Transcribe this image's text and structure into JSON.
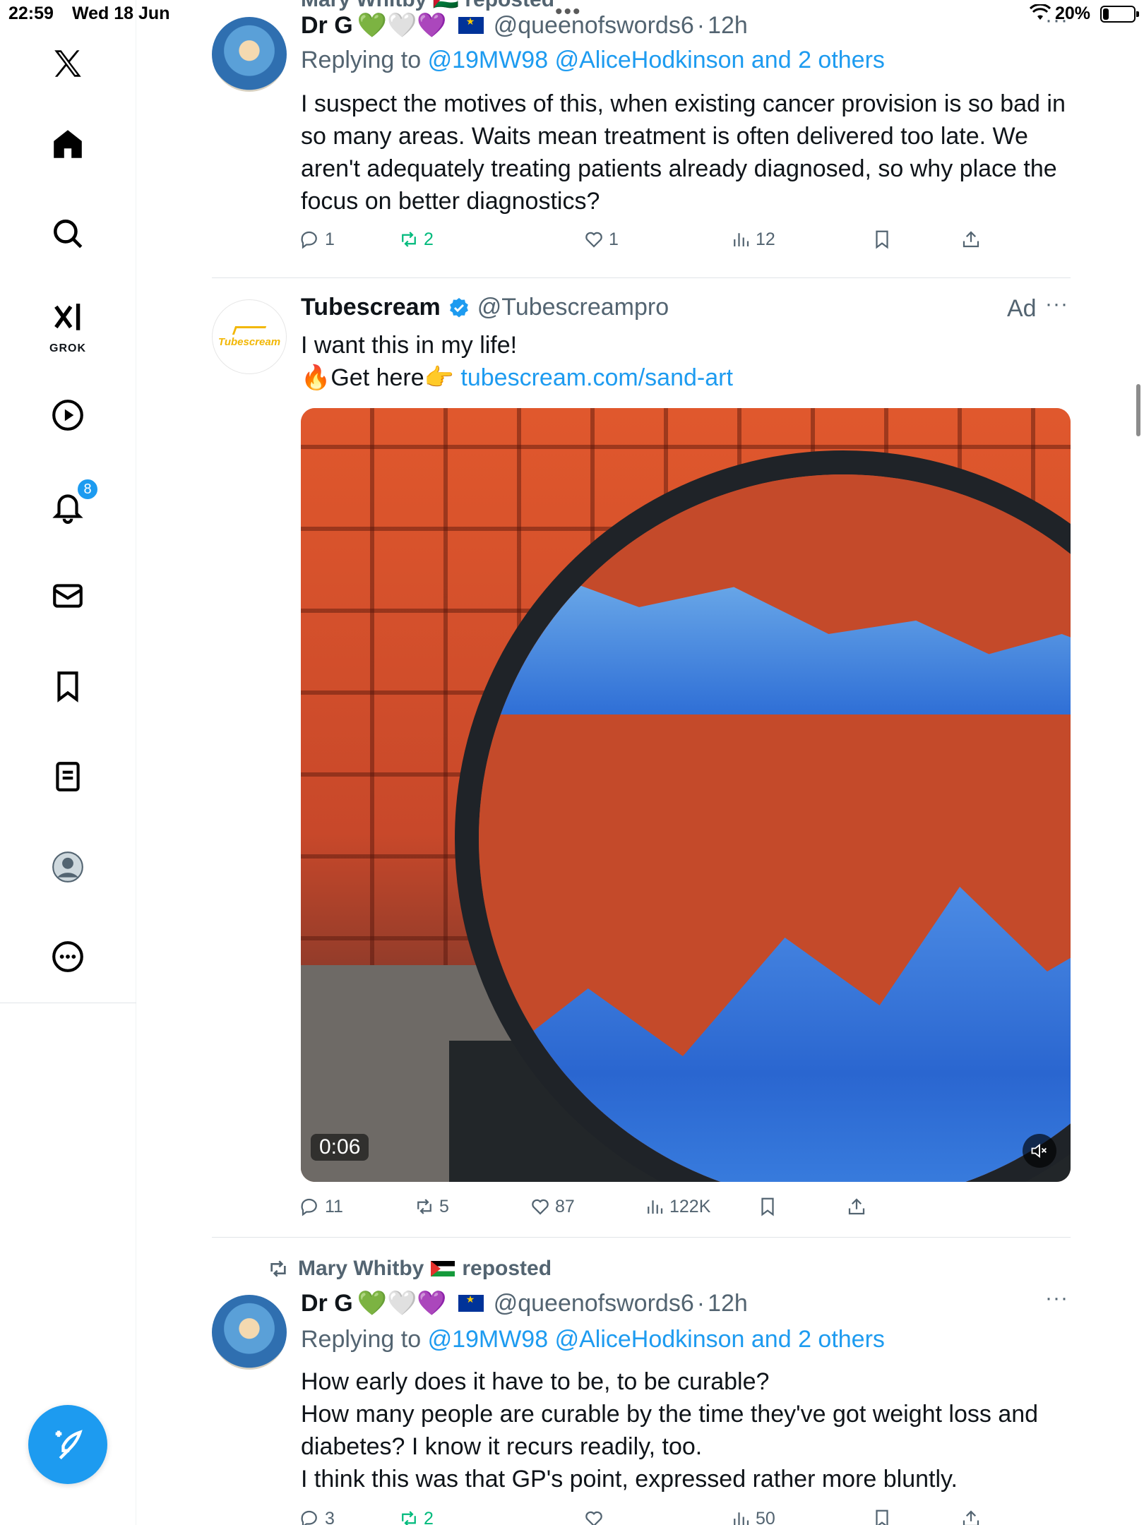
{
  "status_bar": {
    "time": "22:59",
    "date": "Wed 18 Jun",
    "battery_pct": "20%",
    "battery_level": 0.2
  },
  "sidebar": {
    "items": [
      {
        "name": "x-logo",
        "icon": "x-logo-icon"
      },
      {
        "name": "home",
        "icon": "home-icon"
      },
      {
        "name": "explore",
        "icon": "search-icon"
      },
      {
        "name": "grok",
        "icon": "grok-icon",
        "label": "GROK"
      },
      {
        "name": "videos",
        "icon": "play-icon"
      },
      {
        "name": "notifications",
        "icon": "bell-icon",
        "badge": "8"
      },
      {
        "name": "messages",
        "icon": "mail-icon"
      },
      {
        "name": "bookmarks",
        "icon": "bookmark-icon"
      },
      {
        "name": "lists",
        "icon": "list-icon"
      },
      {
        "name": "profile",
        "icon": "avatar-icon"
      },
      {
        "name": "more",
        "icon": "more-circle-icon"
      }
    ],
    "compose_icon": "compose-feather-icon"
  },
  "feed": {
    "top_cutoff": "Mary Whitby 🇵🇸 reposted",
    "tweets": [
      {
        "author": "Dr G",
        "emojis": "💚🤍💜",
        "handle": "@queenofswords6",
        "sep": "·",
        "time": "12h",
        "reply_prefix": "Replying to",
        "reply_users": "@19MW98 @AliceHodkinson",
        "reply_and": "and 2 others",
        "text": "I suspect the motives of this, when existing cancer provision is so bad in so many areas. Waits mean treatment is often delivered too late. We aren't adequately treating patients already diagnosed, so why place the focus on better diagnostics?",
        "replies": "1",
        "reposts": "2",
        "likes": "1",
        "views": "12"
      },
      {
        "author": "Tubescream",
        "handle": "@Tubescreampro",
        "ad_label": "Ad",
        "line1": "I want this in my life!",
        "line2_prefix": "🔥Get here👉",
        "link": "tubescream.com/sand-art",
        "avatar_word": "Tubescream",
        "video_duration": "0:06",
        "replies": "11",
        "reposts": "5",
        "likes": "87",
        "views": "122K"
      },
      {
        "repost_by": "Mary Whitby",
        "repost_suffix": "reposted",
        "author": "Dr G",
        "emojis": "💚🤍💜",
        "handle": "@queenofswords6",
        "sep": "·",
        "time": "12h",
        "reply_prefix": "Replying to",
        "reply_users": "@19MW98 @AliceHodkinson",
        "reply_and": "and 2 others",
        "lines": [
          "How early does it have to be, to be curable?",
          "How many people are curable by the time they've got weight loss and diabetes? I know it recurs readily, too.",
          "I think this was that GP's point, expressed rather more bluntly."
        ],
        "replies": "3",
        "reposts": "2",
        "likes": "",
        "views": "50"
      }
    ]
  },
  "colors": {
    "accent": "#1d9bf0",
    "repost_green": "#00ba7c",
    "muted": "#536471",
    "text": "#0f1419"
  }
}
